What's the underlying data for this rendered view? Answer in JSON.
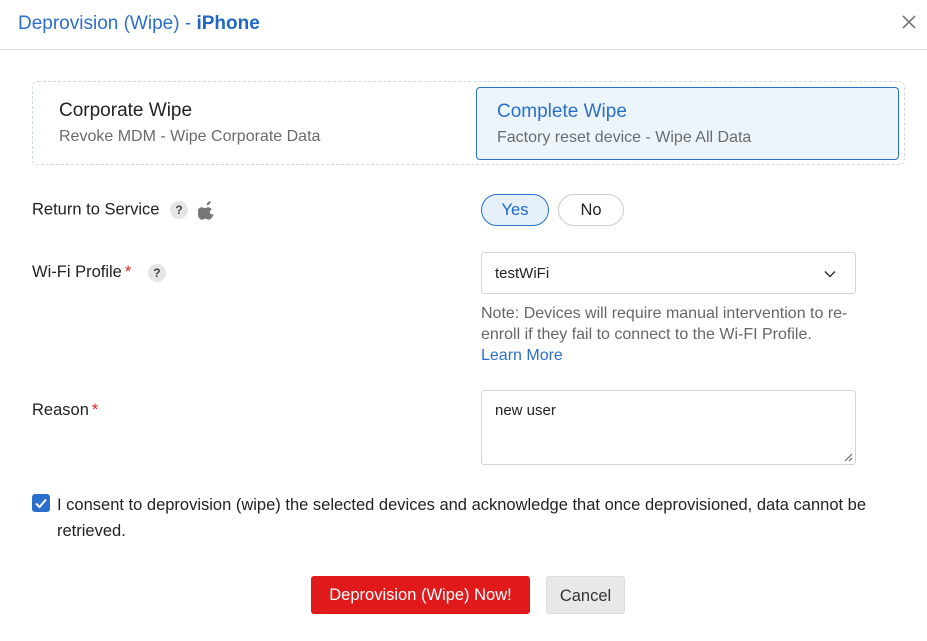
{
  "dialog": {
    "title_prefix": "Deprovision (Wipe) - ",
    "title_device": "iPhone"
  },
  "wipe_options": [
    {
      "title": "Corporate Wipe",
      "subtitle": "Revoke MDM - Wipe Corporate Data",
      "selected": false
    },
    {
      "title": "Complete Wipe",
      "subtitle": "Factory reset device - Wipe All Data",
      "selected": true
    }
  ],
  "return_to_service": {
    "label": "Return to Service",
    "help": "?",
    "yes_label": "Yes",
    "no_label": "No",
    "selected": "Yes"
  },
  "wifi_profile": {
    "label": "Wi-Fi Profile",
    "required_mark": "*",
    "help": "?",
    "value": "testWiFi",
    "note": "Note: Devices will require manual intervention to re-enroll if they fail to connect to the Wi-FI Profile.",
    "learn_more": "Learn More"
  },
  "reason": {
    "label": "Reason",
    "required_mark": "*",
    "value": "new user"
  },
  "consent": {
    "checked": true,
    "text": "I consent to deprovision (wipe) the selected devices and acknowledge that once deprovisioned, data cannot be retrieved."
  },
  "buttons": {
    "wipe_label": "Deprovision (Wipe) Now!",
    "cancel_label": "Cancel"
  },
  "colors": {
    "accent": "#2a6fc9",
    "danger": "#e0191a",
    "selected_bg": "#edf5fc"
  }
}
